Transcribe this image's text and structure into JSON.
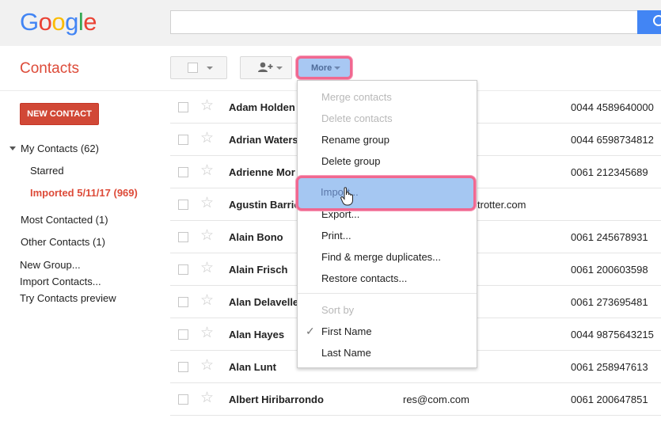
{
  "header": {
    "logo": {
      "letters": [
        "G",
        "o",
        "o",
        "g",
        "l",
        "e"
      ],
      "colors": [
        "#4285f4",
        "#ea4335",
        "#fbbc05",
        "#4285f4",
        "#34a853",
        "#ea4335"
      ]
    },
    "search": {
      "value": "",
      "placeholder": ""
    },
    "search_button_icon": "search-icon"
  },
  "app_title": "Contacts",
  "toolbar": {
    "select_icon": "checkbox",
    "add_contact_icon": "person-add-icon",
    "more_label": "More"
  },
  "sidebar": {
    "new_contact_label": "NEW CONTACT",
    "my_contacts": "My Contacts (62)",
    "starred": "Starred",
    "imported": "Imported 5/11/17 (969)",
    "most_contacted": "Most Contacted (1)",
    "other_contacts": "Other Contacts (1)",
    "new_group": "New Group...",
    "import_contacts": "Import Contacts...",
    "try_preview": "Try Contacts preview"
  },
  "contacts": [
    {
      "name": "Adam Holden",
      "email": "",
      "phone": "0044 4589640000"
    },
    {
      "name": "Adrian Waters",
      "email": "",
      "phone": "0044 6598734812"
    },
    {
      "name": "Adrienne Mor",
      "email": "",
      "phone": "0061 212345689"
    },
    {
      "name": "Agustin Barrio",
      "email": "trotter.com",
      "phone": ""
    },
    {
      "name": "Alain Bono",
      "email": "",
      "phone": "0061 245678931"
    },
    {
      "name": "Alain Frisch",
      "email": "",
      "phone": "0061 200603598"
    },
    {
      "name": "Alan Delavelle",
      "email": "",
      "phone": "0061 273695481"
    },
    {
      "name": "Alan Hayes",
      "email": "",
      "phone": "0044 9875643215"
    },
    {
      "name": "Alan Lunt",
      "email": "",
      "phone": "0061 258947613"
    },
    {
      "name": "Albert Hiribarrondo",
      "email": "res@com.com",
      "phone": "0061 200647851"
    }
  ],
  "more_menu": {
    "merge_contacts": "Merge contacts",
    "delete_contacts": "Delete contacts",
    "rename_group": "Rename group",
    "delete_group": "Delete group",
    "import": "Import...",
    "export": "Export...",
    "print": "Print...",
    "find_merge": "Find & merge duplicates...",
    "restore": "Restore contacts...",
    "sort_by": "Sort by",
    "first_name": "First Name",
    "last_name": "Last Name",
    "checkmark": "✓"
  }
}
